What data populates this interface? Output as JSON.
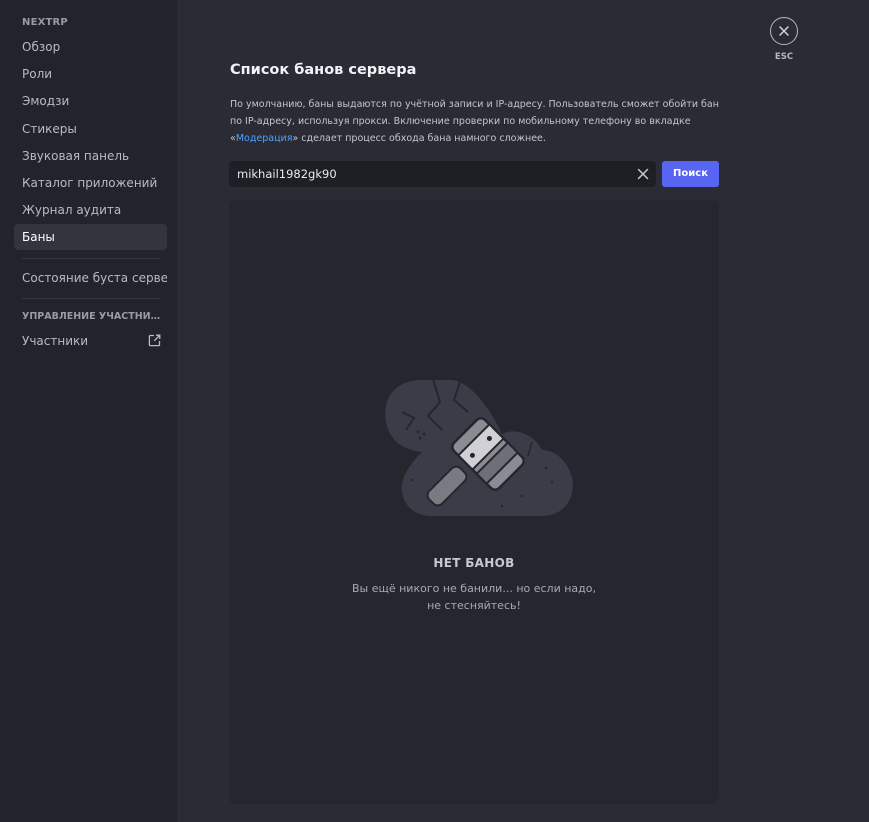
{
  "sidebar": {
    "server_name": "NEXTRP",
    "items": [
      {
        "label": "Обзор"
      },
      {
        "label": "Роли"
      },
      {
        "label": "Эмодзи"
      },
      {
        "label": "Стикеры"
      },
      {
        "label": "Звуковая панель"
      },
      {
        "label": "Каталог приложений"
      },
      {
        "label": "Журнал аудита"
      },
      {
        "label": "Баны"
      }
    ],
    "boost_item": "Состояние буста сервера",
    "members_section": "УПРАВЛЕНИЕ УЧАСТНИКАМИ",
    "members_item": "Участники"
  },
  "main": {
    "title": "Список банов сервера",
    "description_part1": "По умолчанию, баны выдаются по учётной записи и IP-адресу. Пользователь сможет обойти бан по IP-адресу, используя прокси. Включение проверки по мобильному телефону во вкладке «",
    "description_link": "Модерация",
    "description_part2": "» сделает процесс обхода бана намного сложнее.",
    "search": {
      "value": "mikhail1982gk90",
      "button_label": "Поиск"
    },
    "empty": {
      "title": "НЕТ БАНОВ",
      "line1": "Вы ещё никого не банили... но если надо,",
      "line2": "не стесняйтесь!"
    }
  },
  "close": {
    "label": "ESC"
  },
  "icons": {
    "close": "close-icon",
    "clear": "clear-icon",
    "external": "external-link-icon",
    "empty_state": "ban-hammer-illustration"
  },
  "colors": {
    "accent": "#5865f2",
    "link": "#4aa3ff",
    "sidebar_bg": "#23232b",
    "main_bg": "#2b2b35"
  }
}
